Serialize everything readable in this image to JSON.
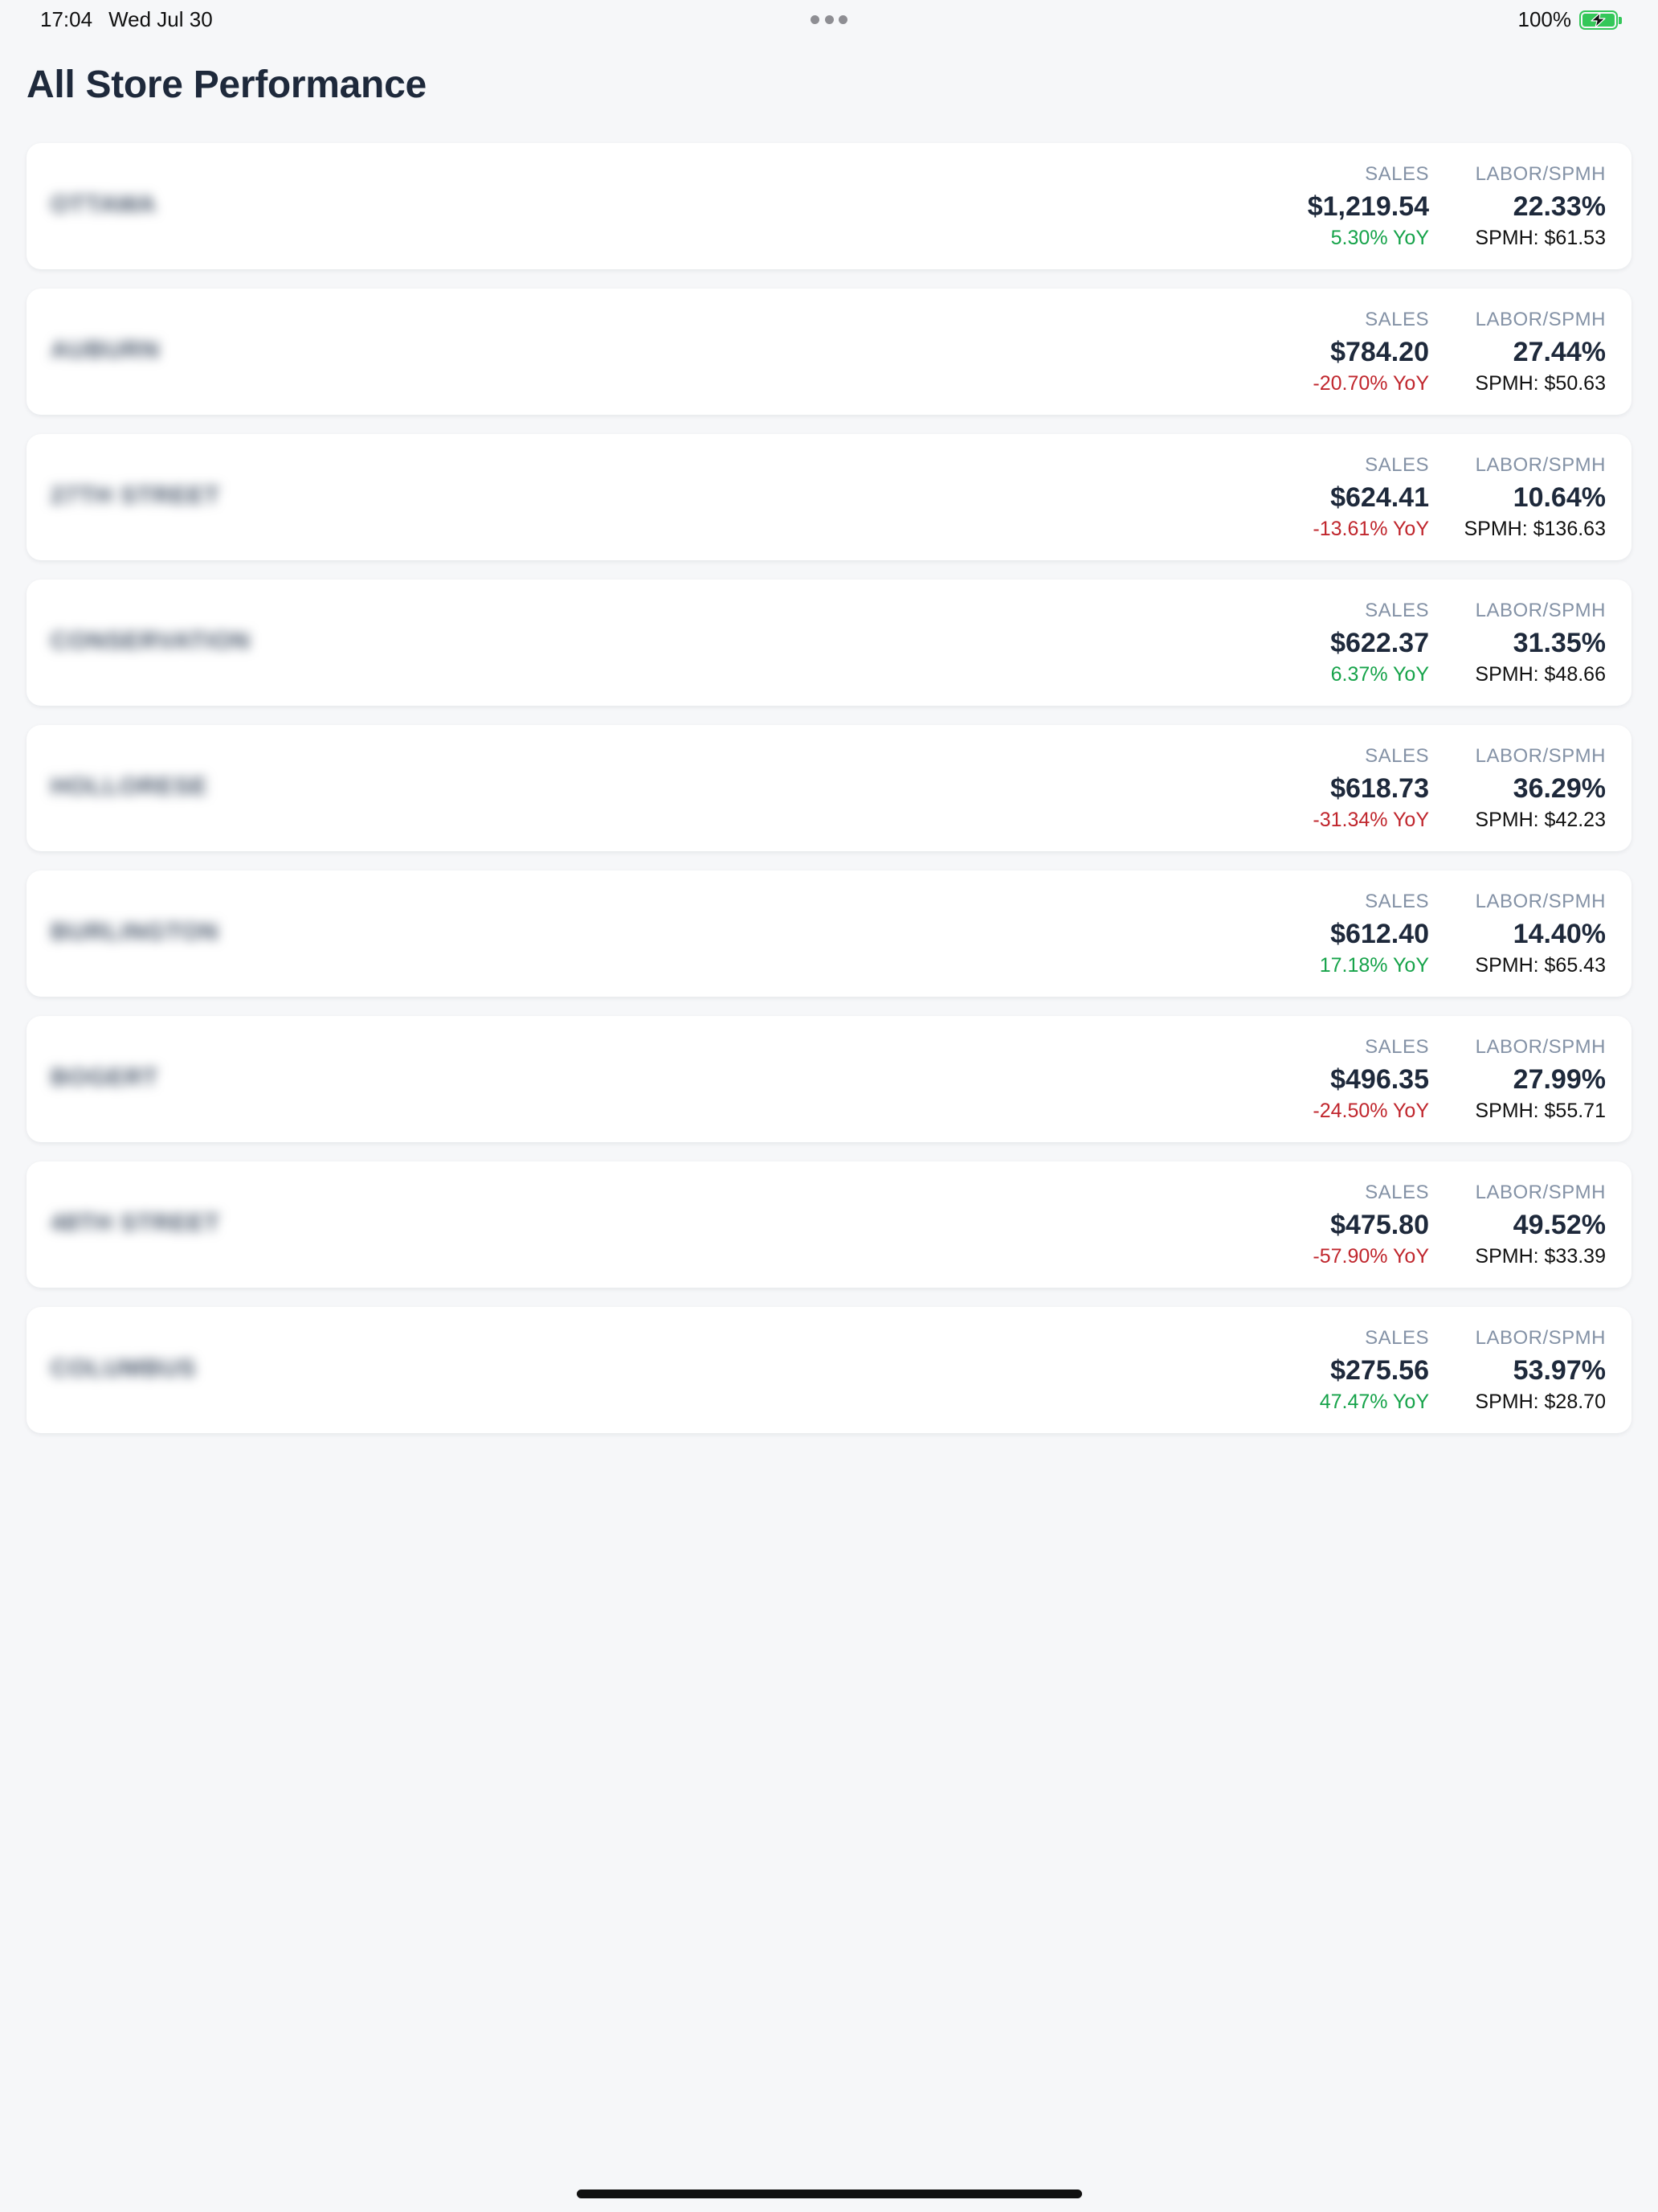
{
  "status_bar": {
    "time": "17:04",
    "date": "Wed Jul 30",
    "battery": "100%",
    "battery_level_percent": 100,
    "battery_color": "#34c759"
  },
  "page": {
    "title": "All Store Performance"
  },
  "colors": {
    "positive": "#16a34a",
    "negative": "#c0262d",
    "title": "#1e293b",
    "label": "#8492a6",
    "background": "#f6f7f9"
  },
  "stores": [
    {
      "name": "OTTAWA",
      "sales_label": "SALES",
      "sales": "$1,219.54",
      "yoy": "5.30% YoY",
      "yoy_positive": true,
      "labor_label": "LABOR/SPMH",
      "labor": "22.33%",
      "spmh": "SPMH: $61.53"
    },
    {
      "name": "AUBURN",
      "sales_label": "SALES",
      "sales": "$784.20",
      "yoy": "-20.70% YoY",
      "yoy_positive": false,
      "labor_label": "LABOR/SPMH",
      "labor": "27.44%",
      "spmh": "SPMH: $50.63"
    },
    {
      "name": "27TH STREET",
      "sales_label": "SALES",
      "sales": "$624.41",
      "yoy": "-13.61% YoY",
      "yoy_positive": false,
      "labor_label": "LABOR/SPMH",
      "labor": "10.64%",
      "spmh": "SPMH: $136.63"
    },
    {
      "name": "CONSERVATION",
      "sales_label": "SALES",
      "sales": "$622.37",
      "yoy": "6.37% YoY",
      "yoy_positive": true,
      "labor_label": "LABOR/SPMH",
      "labor": "31.35%",
      "spmh": "SPMH: $48.66"
    },
    {
      "name": "HOLLORESE",
      "sales_label": "SALES",
      "sales": "$618.73",
      "yoy": "-31.34% YoY",
      "yoy_positive": false,
      "labor_label": "LABOR/SPMH",
      "labor": "36.29%",
      "spmh": "SPMH: $42.23"
    },
    {
      "name": "BURLINGTON",
      "sales_label": "SALES",
      "sales": "$612.40",
      "yoy": "17.18% YoY",
      "yoy_positive": true,
      "labor_label": "LABOR/SPMH",
      "labor": "14.40%",
      "spmh": "SPMH: $65.43"
    },
    {
      "name": "BOGERT",
      "sales_label": "SALES",
      "sales": "$496.35",
      "yoy": "-24.50% YoY",
      "yoy_positive": false,
      "labor_label": "LABOR/SPMH",
      "labor": "27.99%",
      "spmh": "SPMH: $55.71"
    },
    {
      "name": "48TH STREET",
      "sales_label": "SALES",
      "sales": "$475.80",
      "yoy": "-57.90% YoY",
      "yoy_positive": false,
      "labor_label": "LABOR/SPMH",
      "labor": "49.52%",
      "spmh": "SPMH: $33.39"
    },
    {
      "name": "COLUMBUS",
      "sales_label": "SALES",
      "sales": "$275.56",
      "yoy": "47.47% YoY",
      "yoy_positive": true,
      "labor_label": "LABOR/SPMH",
      "labor": "53.97%",
      "spmh": "SPMH: $28.70"
    }
  ]
}
